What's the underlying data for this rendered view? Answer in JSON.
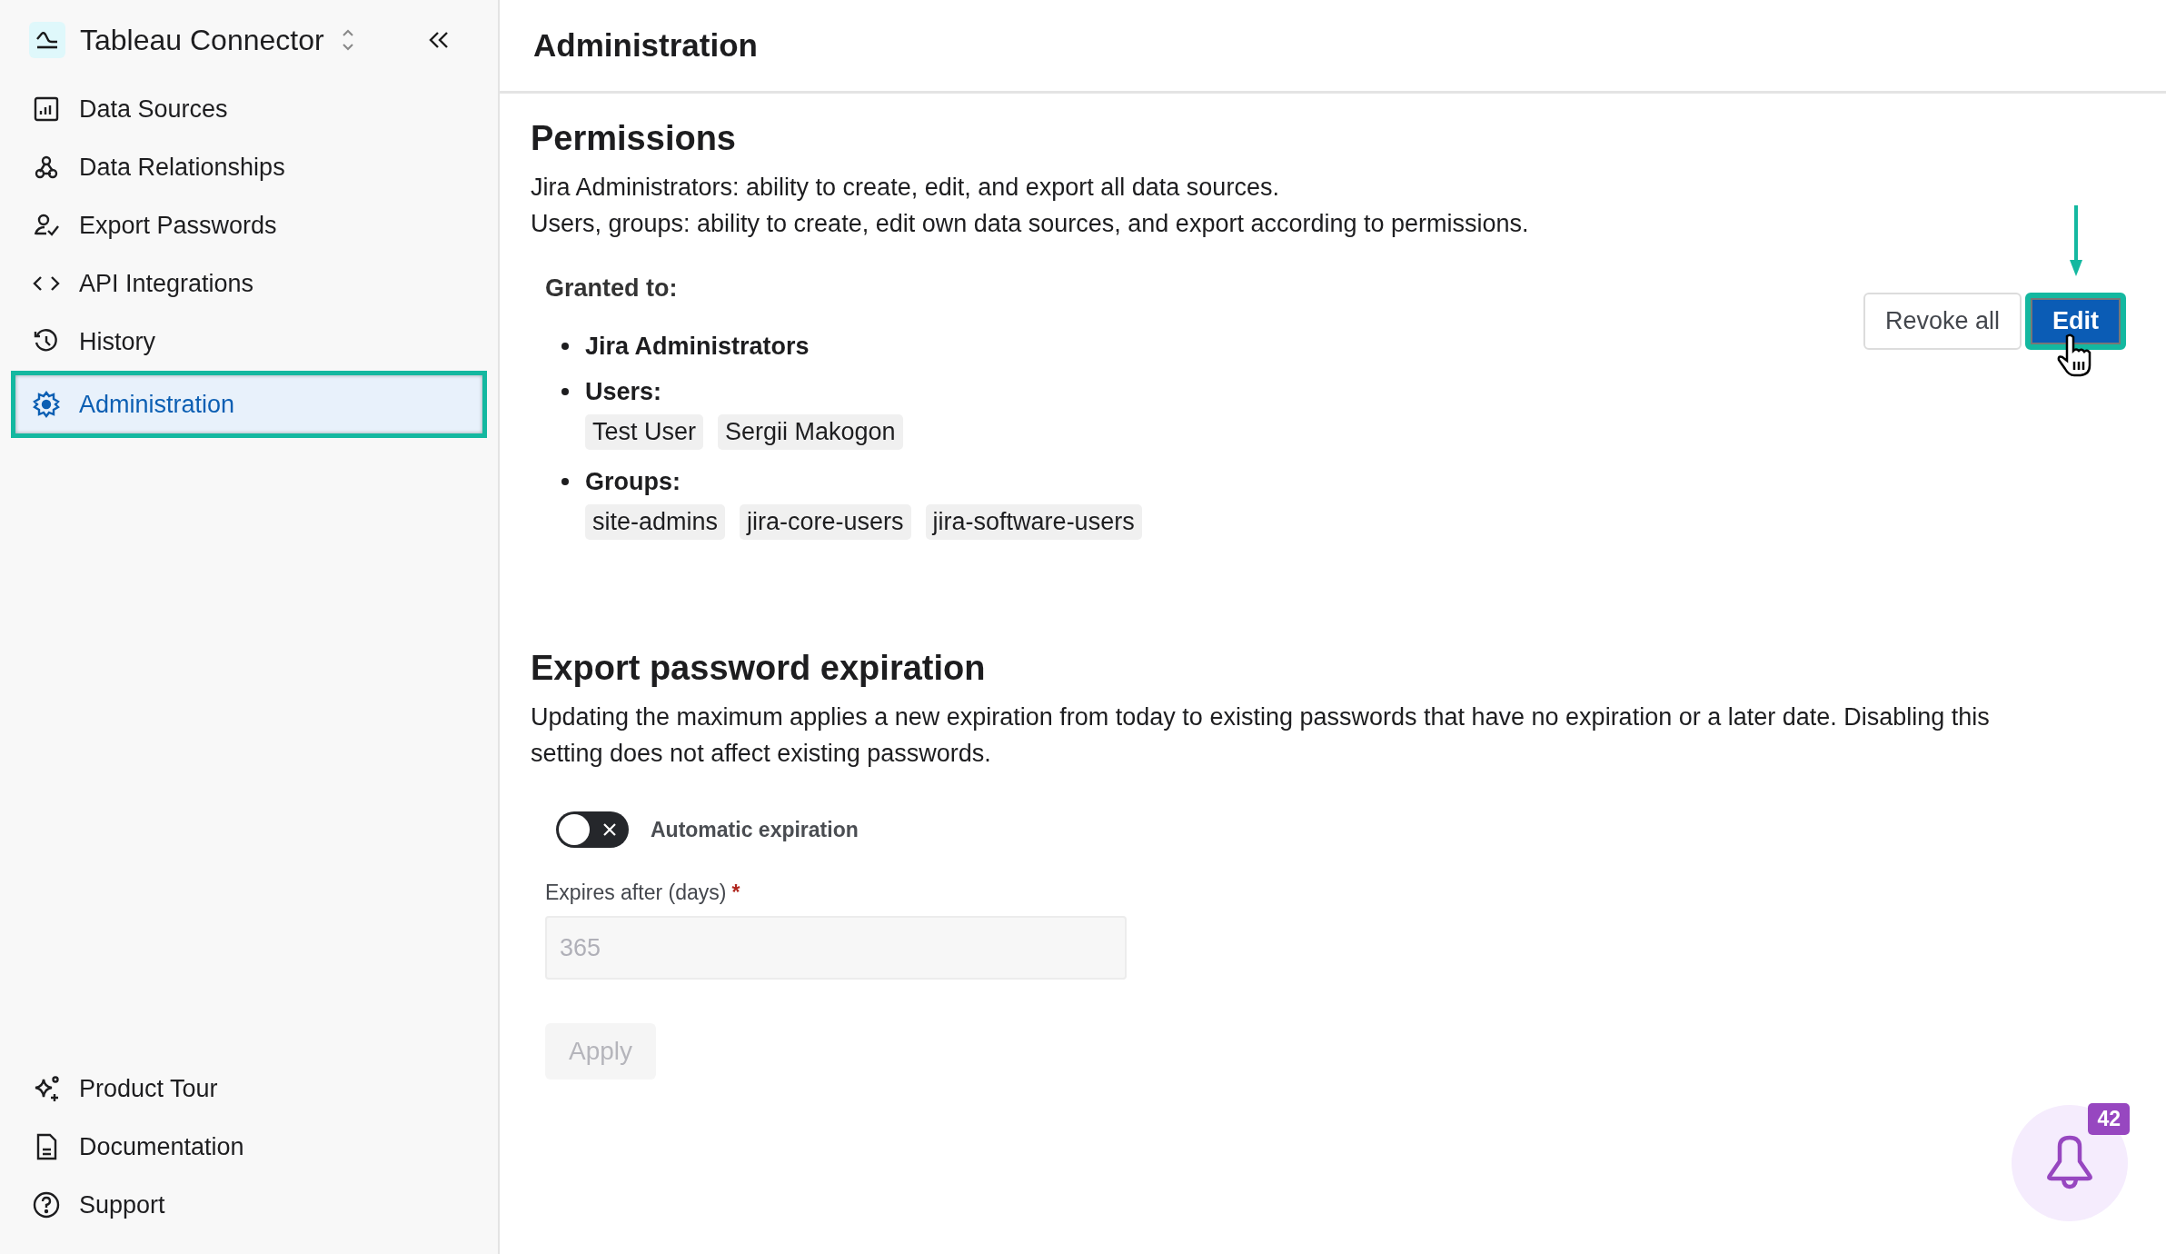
{
  "app": {
    "title": "Tableau Connector"
  },
  "nav": [
    {
      "label": "Data Sources",
      "selected": false,
      "highlighted": false
    },
    {
      "label": "Data Relationships",
      "selected": false,
      "highlighted": false
    },
    {
      "label": "Export Passwords",
      "selected": false,
      "highlighted": false
    },
    {
      "label": "API Integrations",
      "selected": false,
      "highlighted": false
    },
    {
      "label": "History",
      "selected": false,
      "highlighted": false
    },
    {
      "label": "Administration",
      "selected": true,
      "highlighted": true
    }
  ],
  "footer_nav": [
    {
      "label": "Product Tour"
    },
    {
      "label": "Documentation"
    },
    {
      "label": "Support"
    }
  ],
  "page": {
    "title": "Administration"
  },
  "permissions": {
    "heading": "Permissions",
    "description": [
      "Jira Administrators: ability to create, edit, and export all data sources.",
      "Users, groups: ability to create, edit own data sources, and export according to permissions."
    ],
    "granted_label": "Granted to:",
    "grants": [
      {
        "label": "Jira Administrators"
      },
      {
        "label": "Users:",
        "chips": [
          "Test User",
          "Sergii Makogon"
        ]
      },
      {
        "label": "Groups:",
        "chips": [
          "site-admins",
          "jira-core-users",
          "jira-software-users"
        ]
      }
    ],
    "buttons": [
      {
        "label": "Revoke all",
        "kind": "secondary",
        "highlighted": false
      },
      {
        "label": "Edit",
        "kind": "primary",
        "highlighted": true,
        "arrow": true,
        "cursor": true
      }
    ]
  },
  "expiration": {
    "heading": "Export password expiration",
    "description": "Updating the maximum applies a new expiration from today to existing passwords that have no expiration or a later date. Disabling this setting does not affect existing passwords.",
    "toggle": {
      "label": "Automatic expiration",
      "on": false
    },
    "field": {
      "label": "Expires after (days)",
      "required_mark": "*",
      "value": "365",
      "disabled": true
    },
    "apply": {
      "label": "Apply",
      "disabled": true
    }
  },
  "notifications": {
    "count": "42"
  }
}
